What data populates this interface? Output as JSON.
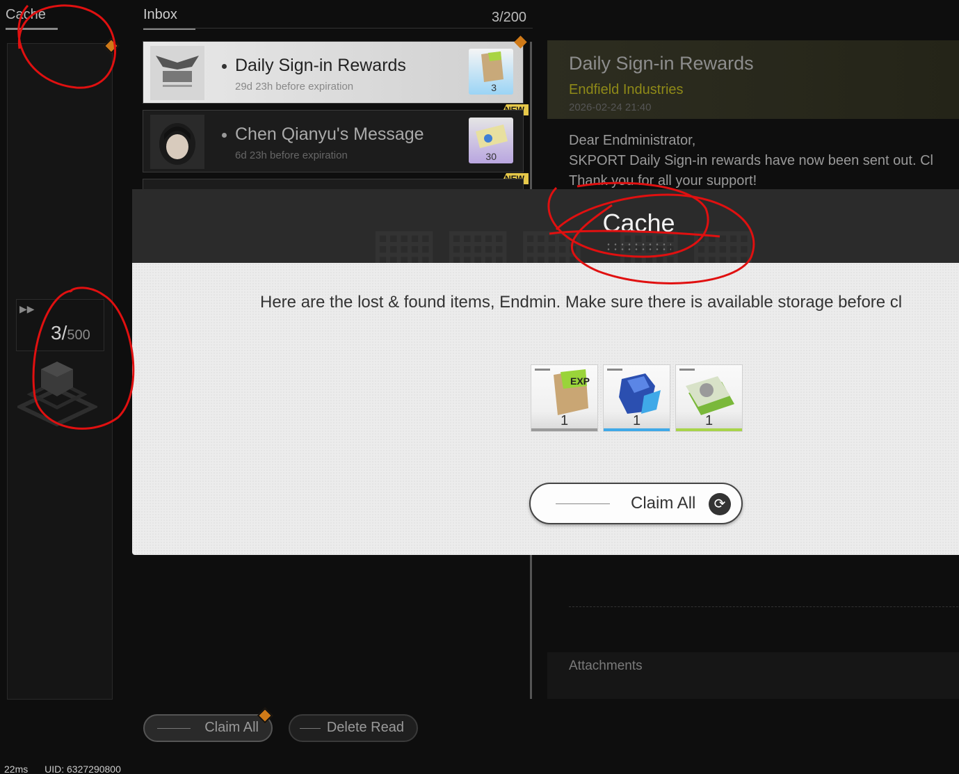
{
  "sidebar": {
    "tab_label": "Cache",
    "count_current": "3/",
    "count_max": "500"
  },
  "inbox": {
    "tab_label": "Inbox",
    "count": "3/200",
    "mails": [
      {
        "title": "Daily Sign-in Rewards",
        "expiry": "29d 23h before expiration",
        "item_qty": "3",
        "badge": ""
      },
      {
        "title": "Chen Qianyu's Message",
        "expiry": "6d 23h before expiration",
        "item_qty": "30",
        "badge": "NEW"
      },
      {
        "badge": "NEW"
      }
    ],
    "claim_all_label": "Claim All",
    "delete_read_label": "Delete Read"
  },
  "detail": {
    "title": "Daily Sign-in Rewards",
    "sender": "Endfield Industries",
    "date": "2026-02-24 21:40",
    "body_lines": [
      "Dear Endministrator,",
      "SKPORT Daily Sign-in rewards have now been sent out. Cl",
      "Thank you for all your support!"
    ],
    "attachments_label": "Attachments"
  },
  "modal": {
    "title": "Cache",
    "message": "Here are the lost & found items, Endmin. Make sure there is available storage before cl",
    "rewards": [
      {
        "qty": "1",
        "rarity_color": "#9a9a9a"
      },
      {
        "qty": "1",
        "rarity_color": "#3fa9e8"
      },
      {
        "qty": "1",
        "rarity_color": "#a8d44a"
      }
    ],
    "claim_all_label": "Claim All"
  },
  "status": {
    "latency": "22ms",
    "uid": "UID: 6327290800"
  },
  "colors": {
    "accent_orange": "#d07a18",
    "new_badge": "#e6c84a",
    "sender_yellow": "#8f8a18",
    "annotation_red": "#e01010"
  }
}
